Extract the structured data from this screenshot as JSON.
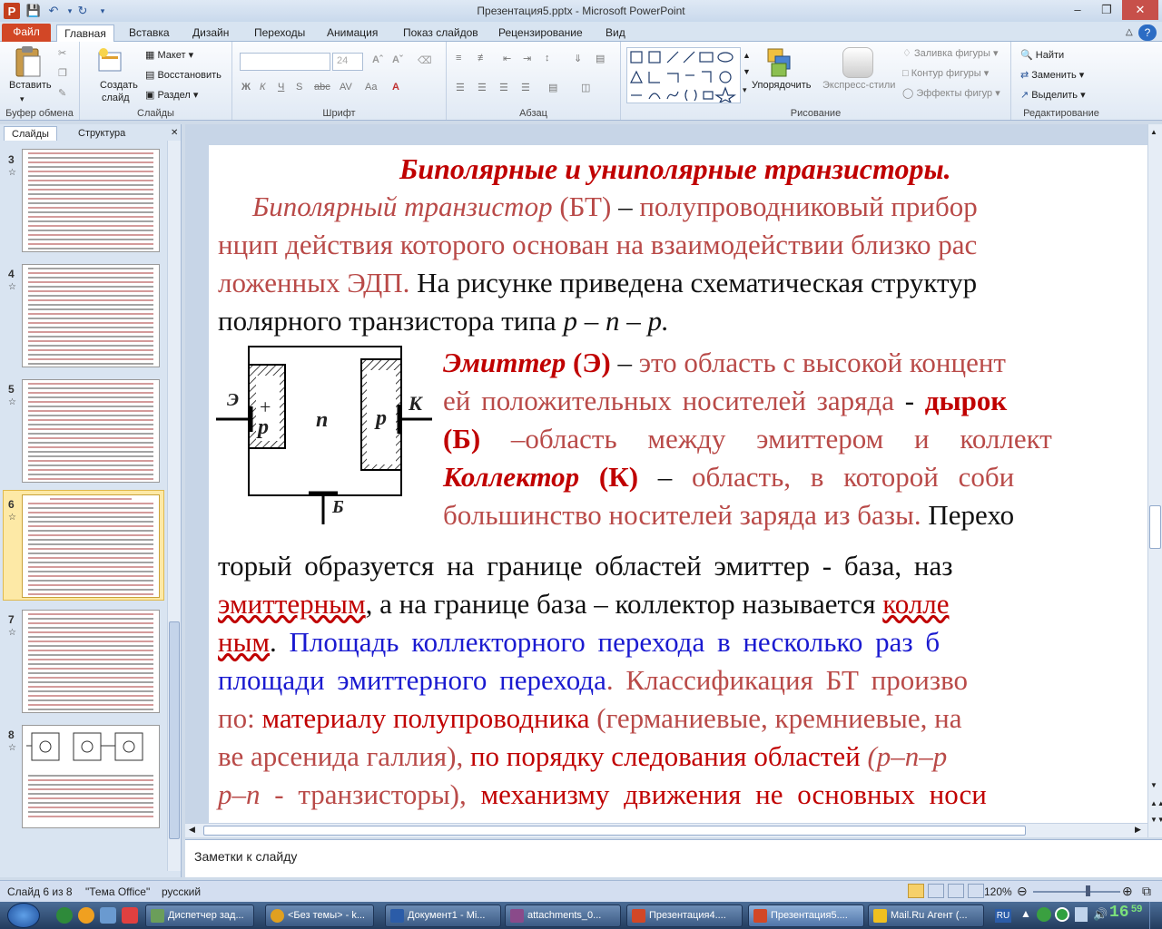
{
  "window": {
    "title": "Презентация5.pptx - Microsoft PowerPoint"
  },
  "tabs": [
    "Файл",
    "Главная",
    "Вставка",
    "Дизайн",
    "Переходы",
    "Анимация",
    "Показ слайдов",
    "Рецензирование",
    "Вид"
  ],
  "ribbon": {
    "clipboard": {
      "label": "Буфер обмена",
      "paste": "Вставить"
    },
    "slides": {
      "label": "Слайды",
      "new_slide_1": "Создать",
      "new_slide_2": "слайд",
      "layout": "Макет",
      "reset": "Восстановить",
      "section": "Раздел"
    },
    "font": {
      "label": "Шрифт",
      "size": "24"
    },
    "paragraph": {
      "label": "Абзац"
    },
    "drawing": {
      "label": "Рисование",
      "arrange": "Упорядочить",
      "quick_styles": "Экспресс-стили",
      "fill": "Заливка фигуры",
      "outline": "Контур фигуры",
      "effects": "Эффекты фигур"
    },
    "editing": {
      "label": "Редактирование",
      "find": "Найти",
      "replace": "Заменить",
      "select": "Выделить"
    }
  },
  "left_panel": {
    "tab_slides": "Слайды",
    "tab_outline": "Структура",
    "slide_numbers": [
      "3",
      "4",
      "5",
      "6",
      "7",
      "8"
    ]
  },
  "slide": {
    "title": "Биполярные и униполярные транзисторы.",
    "p1_term": "Биполярный транзистор",
    "p1_abbr": "(БТ)",
    "p1_dash": "–",
    "p1_rest": "полупроводниковый прибор",
    "p2": "нцип действия которого основан на взаимодействии близко рас",
    "p3_red": "ложенных ЭДП.",
    "p3_black": "На рисунке приведена схематическая структур",
    "p4": "полярного транзистора типа",
    "p4_formula": "p – n – p.",
    "emitter_term": "Эмиттер",
    "emitter_abbr": "(Э)",
    "emitter_dash": "–",
    "emitter_def": "это область с высокой концент",
    "line_b1": "ей положительных носителей заряда",
    "line_b1_dash": "-",
    "line_b1_end": "дырок",
    "base_abbr": "(Б)",
    "base_def": "–область между эмиттером и коллект",
    "collector_term": "Коллектор",
    "collector_abbr": "(К)",
    "collector_dash": "–",
    "collector_def": "область, в которой соби",
    "line_c2_red": "большинство носителей заряда из базы.",
    "line_c2_black": "Перехо",
    "p5": "торый образуется на границе областей эмиттер - база, наз",
    "p6_red": "эмиттерным",
    "p6_black": ", а на границе база – коллектор называется",
    "p6_red2": "колле",
    "p7_red": "ным",
    "p7_dot": ".",
    "p7_blue": "Площадь коллекторного перехода в несколько раз б",
    "p8_blue": "площади эмиттерного перехода",
    "p8_red": ". Классификация БТ произво",
    "p9_red": "по:",
    "p9_dred": "материалу полупроводника",
    "p9_red2": "(германиевые, кремниевые, на",
    "p10_red": "ве арсенида галлия),",
    "p10_dred": "по порядку следования областей",
    "p10_red2": "(p–n–p",
    "p11_red": "p–n",
    "p11_dash": "- транзисторы),",
    "p11_dred": "механизму движения не основных носи",
    "diagram": {
      "e": "Э",
      "k": "К",
      "b": "Б",
      "p1": "p",
      "n": "n",
      "p2": "p",
      "plus": "+"
    }
  },
  "notes_placeholder": "Заметки к слайду",
  "status": {
    "slide": "Слайд 6 из 8",
    "theme": "\"Тема Office\"",
    "lang": "русский",
    "zoom": "120%"
  },
  "taskbar": {
    "items": [
      "Диспетчер зад...",
      "<Без темы> - k...",
      "Документ1 - Mi...",
      "attachments_0...",
      "Презентация4....",
      "Презентация5....",
      "Mail.Ru Агент (..."
    ],
    "lang": "RU",
    "clock": "16",
    "clock_min": "59"
  }
}
